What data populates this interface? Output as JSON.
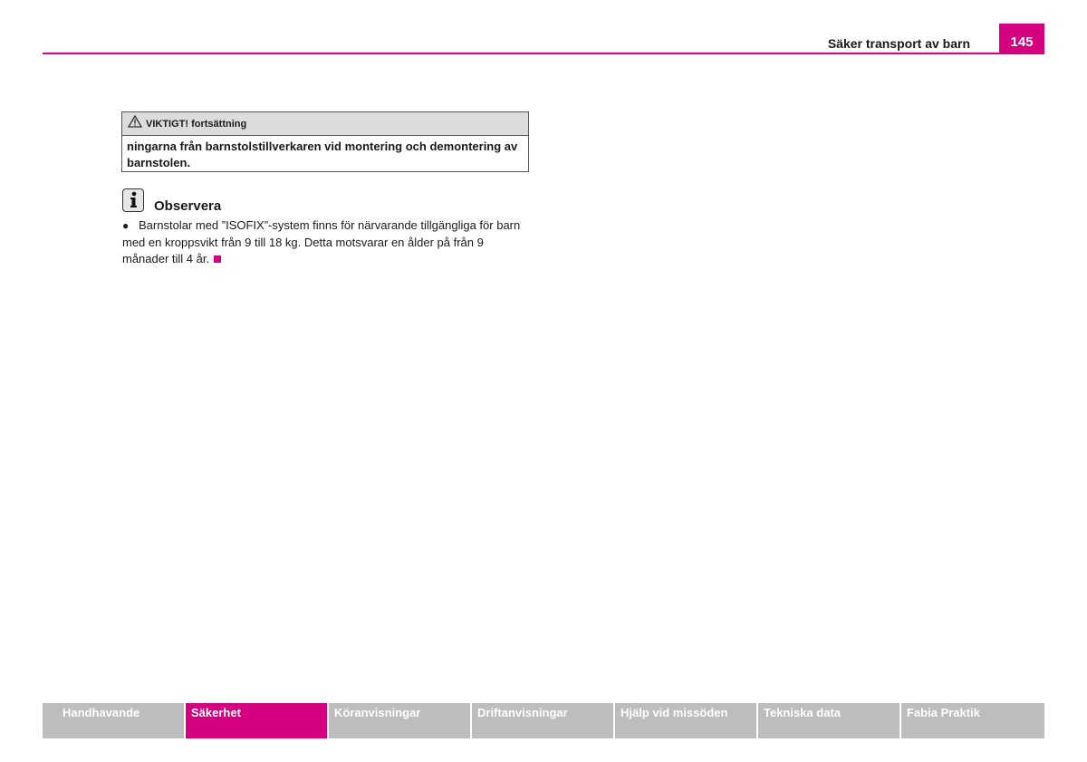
{
  "header": {
    "section_title": "Säker transport av barn",
    "page_number": "145"
  },
  "warning": {
    "heading": "VIKTIGT! fortsättning",
    "body": "ningarna från barnstolstillverkaren vid montering och demontering av barnstolen."
  },
  "note": {
    "title": "Observera",
    "bullet": "●",
    "text": "Barnstolar med ”ISOFIX”-system finns för närvarande tillgängliga för barn med en kroppsvikt från 9 till 18 kg. Detta motsvarar en ålder på från 9 månader till 4 år."
  },
  "footer": {
    "tabs": [
      {
        "label": "Handhavande",
        "active": false
      },
      {
        "label": "Säkerhet",
        "active": true
      },
      {
        "label": "Köranvisningar",
        "active": false
      },
      {
        "label": "Driftanvisningar",
        "active": false
      },
      {
        "label": "Hjälp vid missöden",
        "active": false
      },
      {
        "label": "Tekniska data",
        "active": false
      },
      {
        "label": "Fabia Praktik",
        "active": false
      }
    ]
  },
  "colors": {
    "accent": "#d4007f",
    "tab_inactive": "#bdbdbd",
    "warning_header": "#dcdcdc"
  },
  "icons": {
    "warning": "warning-triangle-icon",
    "note": "info-icon",
    "end_marker": "end-square-icon"
  }
}
